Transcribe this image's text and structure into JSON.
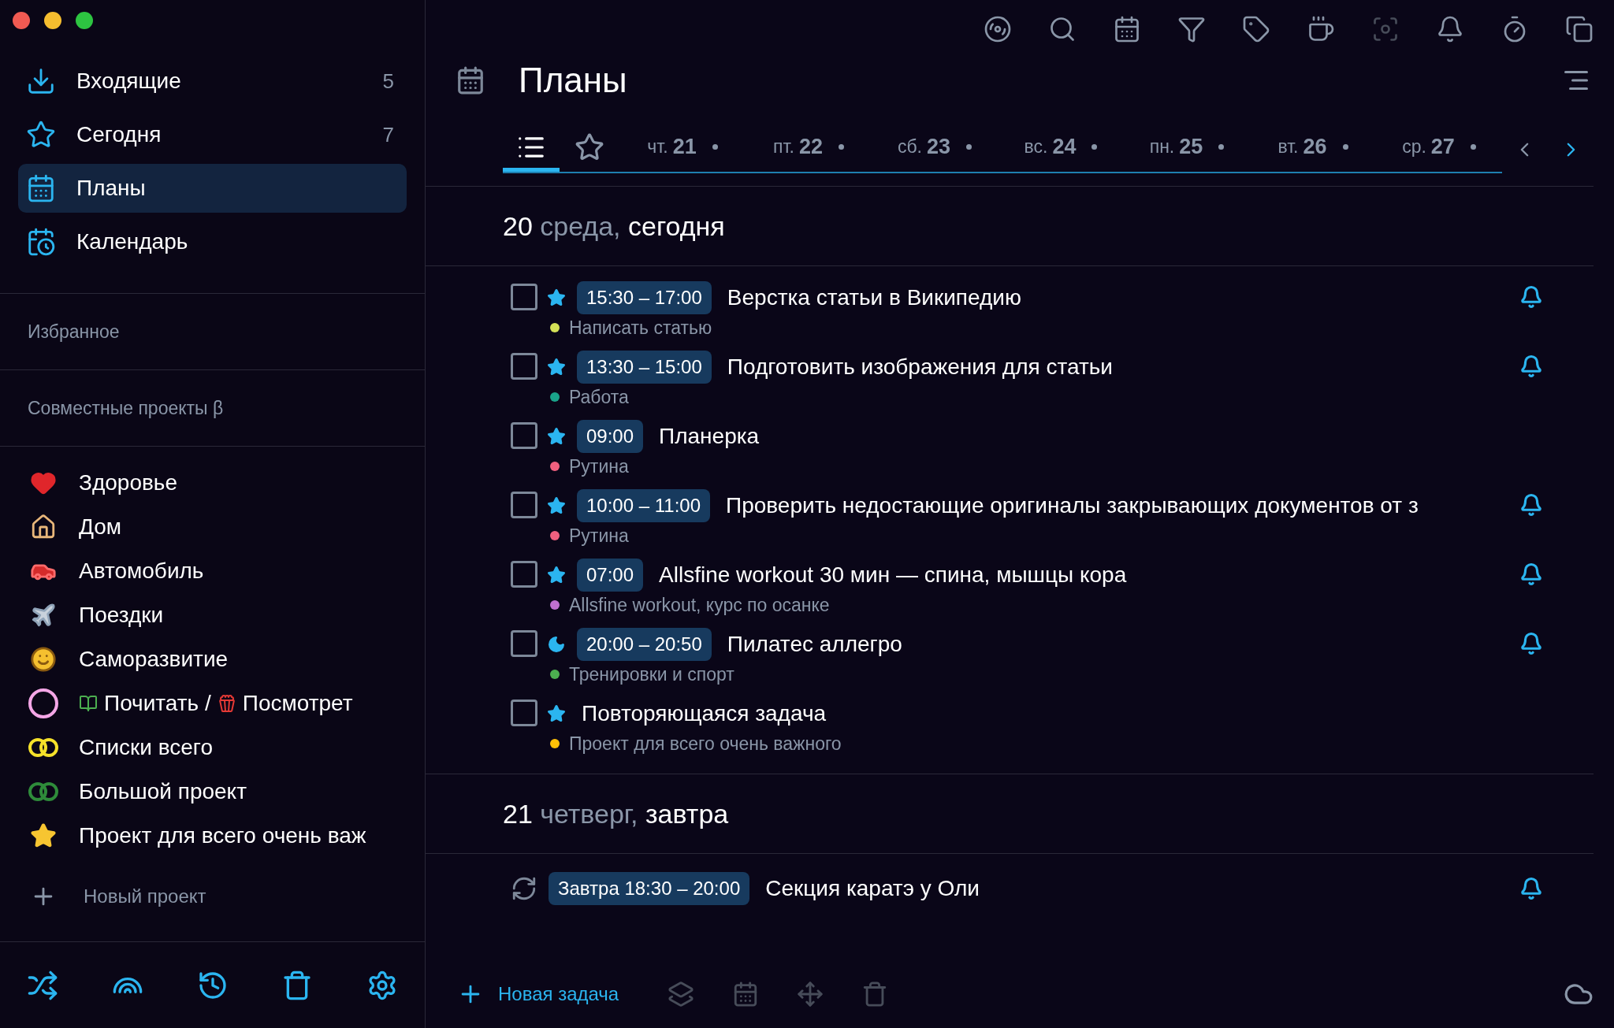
{
  "sidebar": {
    "nav": [
      {
        "kind": "inbox",
        "label": "Входящие",
        "count": "5",
        "selected": false
      },
      {
        "kind": "star",
        "label": "Сегодня",
        "count": "7",
        "selected": false
      },
      {
        "kind": "calendar",
        "label": "Планы",
        "selected": true
      },
      {
        "kind": "calendar-clock",
        "label": "Календарь",
        "selected": false
      }
    ],
    "sections": [
      "Избранное",
      "Совместные проекты β"
    ],
    "projects": [
      {
        "kind": "heart",
        "parts": [
          {
            "text": "Здоровье"
          }
        ]
      },
      {
        "kind": "house",
        "parts": [
          {
            "text": "Дом"
          }
        ]
      },
      {
        "kind": "car",
        "parts": [
          {
            "text": "Автомобиль"
          }
        ]
      },
      {
        "kind": "plane",
        "parts": [
          {
            "text": "Поездки"
          }
        ]
      },
      {
        "kind": "smile",
        "parts": [
          {
            "text": "Саморазвитие"
          }
        ]
      },
      {
        "kind": "circle",
        "color": "#f4a6e6",
        "parts": [
          {
            "kind": "books",
            "text": "Почитать /"
          },
          {
            "kind": "popcorn",
            "text": "Посмотрет"
          }
        ]
      },
      {
        "kind": "rings",
        "color": "#f5e12a",
        "parts": [
          {
            "text": "Списки всего"
          }
        ]
      },
      {
        "kind": "rings",
        "color": "#2e8b3a",
        "parts": [
          {
            "text": "Большой проект"
          }
        ]
      },
      {
        "kind": "gold-star",
        "parts": [
          {
            "text": "Проект для всего очень важ"
          }
        ]
      }
    ],
    "new_project": "Новый проект"
  },
  "main": {
    "title": "Планы",
    "tabs": [
      {
        "kind": "list",
        "selected": true
      },
      {
        "kind": "star",
        "selected": false
      },
      {
        "kind": "day",
        "weekday": "чт.",
        "day": "21",
        "selected": false
      },
      {
        "kind": "day",
        "weekday": "пт.",
        "day": "22",
        "selected": false
      },
      {
        "kind": "day",
        "weekday": "сб.",
        "day": "23",
        "selected": false
      },
      {
        "kind": "day",
        "weekday": "вс.",
        "day": "24",
        "selected": false
      },
      {
        "kind": "day",
        "weekday": "пн.",
        "day": "25",
        "selected": false
      },
      {
        "kind": "day",
        "weekday": "вт.",
        "day": "26",
        "selected": false
      },
      {
        "kind": "day",
        "weekday": "ср.",
        "day": "27",
        "selected": false
      }
    ],
    "sections": [
      {
        "day": "20",
        "weekday": "среда,",
        "relative": "сегодня",
        "tasks": [
          {
            "kind": "starred",
            "checked": false,
            "time": "15:30 – 17:00",
            "title": "Верстка статьи в Википедию",
            "project": "Написать статью",
            "color": "#d4e157",
            "reminder": true
          },
          {
            "kind": "starred",
            "checked": false,
            "time": "13:30 – 15:00",
            "title": "Подготовить изображения для статьи",
            "project": "Работа",
            "color": "#1aa38a",
            "reminder": true
          },
          {
            "kind": "starred",
            "checked": false,
            "time": "09:00",
            "title": "Планерка",
            "project": "Рутина",
            "color": "#f0607f",
            "reminder": false
          },
          {
            "kind": "starred",
            "checked": false,
            "time": "10:00 – 11:00",
            "title": "Проверить недостающие оригиналы закрывающих документов от з",
            "project": "Рутина",
            "color": "#f0607f",
            "reminder": true
          },
          {
            "kind": "starred",
            "checked": false,
            "time": "07:00",
            "title": "Allsfine workout 30 мин — спина, мышцы кора",
            "project": "Allsfine workout, курс по осанке",
            "color": "#c070d0",
            "reminder": true
          },
          {
            "kind": "evening",
            "checked": false,
            "time": "20:00 – 20:50",
            "title": "Пилатес аллегро",
            "project": "Тренировки и спорт",
            "color": "#4caf50",
            "reminder": true
          },
          {
            "kind": "starred",
            "checked": false,
            "title": "Повторяющаяся задача",
            "project": "Проект для всего очень важного",
            "color": "#ffc107",
            "reminder": false
          }
        ]
      },
      {
        "day": "21",
        "weekday": "четверг,",
        "relative": "завтра",
        "tasks": [
          {
            "kind": "recurring",
            "time": "Завтра 18:30 – 20:00",
            "title": "Секция каратэ у Оли",
            "reminder": true
          }
        ]
      }
    ],
    "new_task": "Новая задача"
  }
}
